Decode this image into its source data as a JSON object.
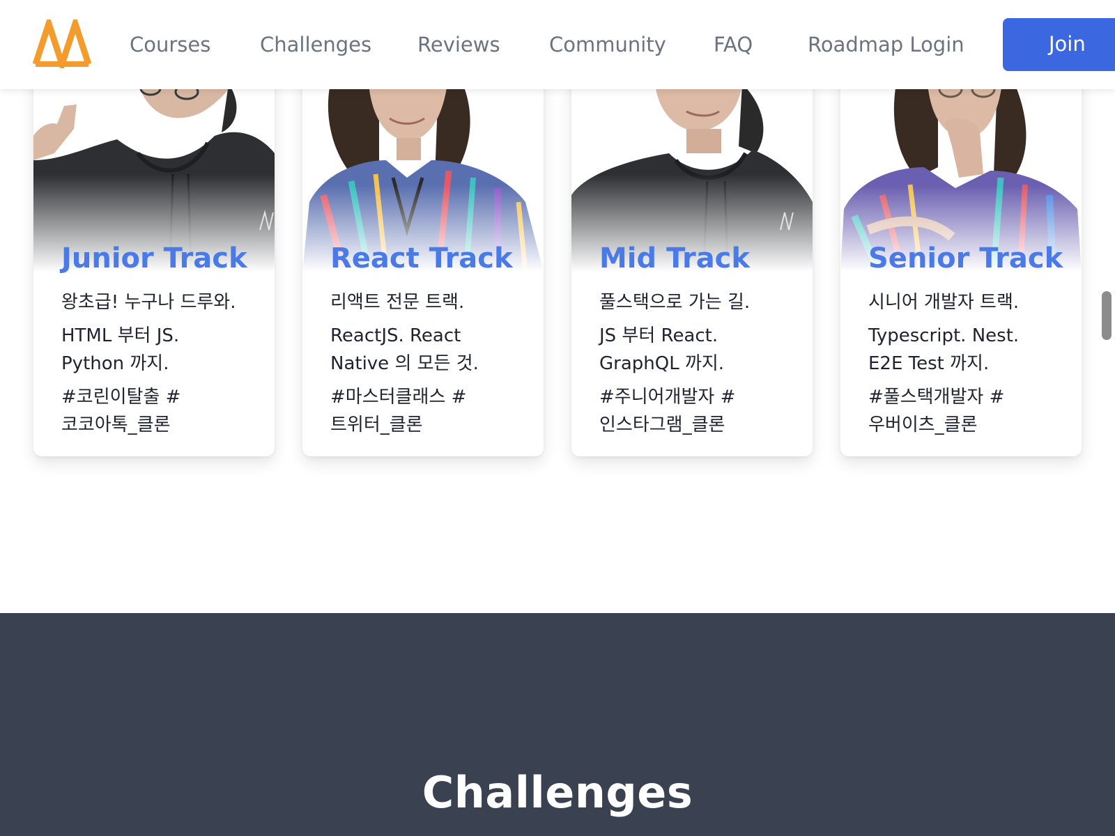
{
  "colors": {
    "brand_orange": "#f39c2d",
    "accent_blue": "#4a7ae8",
    "join_blue": "#3b67e0",
    "nav_gray": "#6b7280",
    "section_dark": "#3a4150"
  },
  "header": {
    "logo_icon": "nomad-logo-icon",
    "nav": {
      "courses": "Courses",
      "challenges": "Challenges",
      "reviews": "Reviews",
      "community": "Community",
      "faq": "FAQ",
      "roadmap_login": "Roadmap Login"
    },
    "join_label": "Join"
  },
  "tracks": [
    {
      "title": "Junior Track",
      "line1": "왕초급! 누구나 드루와.",
      "line2": "HTML 부터 JS.",
      "line3": "Python 까지.",
      "line4": "#코린이탈출 #",
      "line5": "코코아톡_클론"
    },
    {
      "title": "React Track",
      "line1": "리액트 전문 트랙.",
      "line2": "ReactJS. React",
      "line3": "Native 의 모든 것.",
      "line4": "#마스터클래스 #",
      "line5": "트위터_클론"
    },
    {
      "title": "Mid Track",
      "line1": "풀스택으로 가는 길.",
      "line2": "JS 부터 React.",
      "line3": "GraphQL 까지.",
      "line4": "#주니어개발자 #",
      "line5": "인스타그램_클론"
    },
    {
      "title": "Senior Track",
      "line1": "시니어 개발자 트랙.",
      "line2": "Typescript. Nest.",
      "line3": "E2E Test 까지.",
      "line4": "#풀스택개발자 #",
      "line5": "우버이츠_클론"
    }
  ],
  "challenges_section": {
    "title": "Challenges"
  }
}
